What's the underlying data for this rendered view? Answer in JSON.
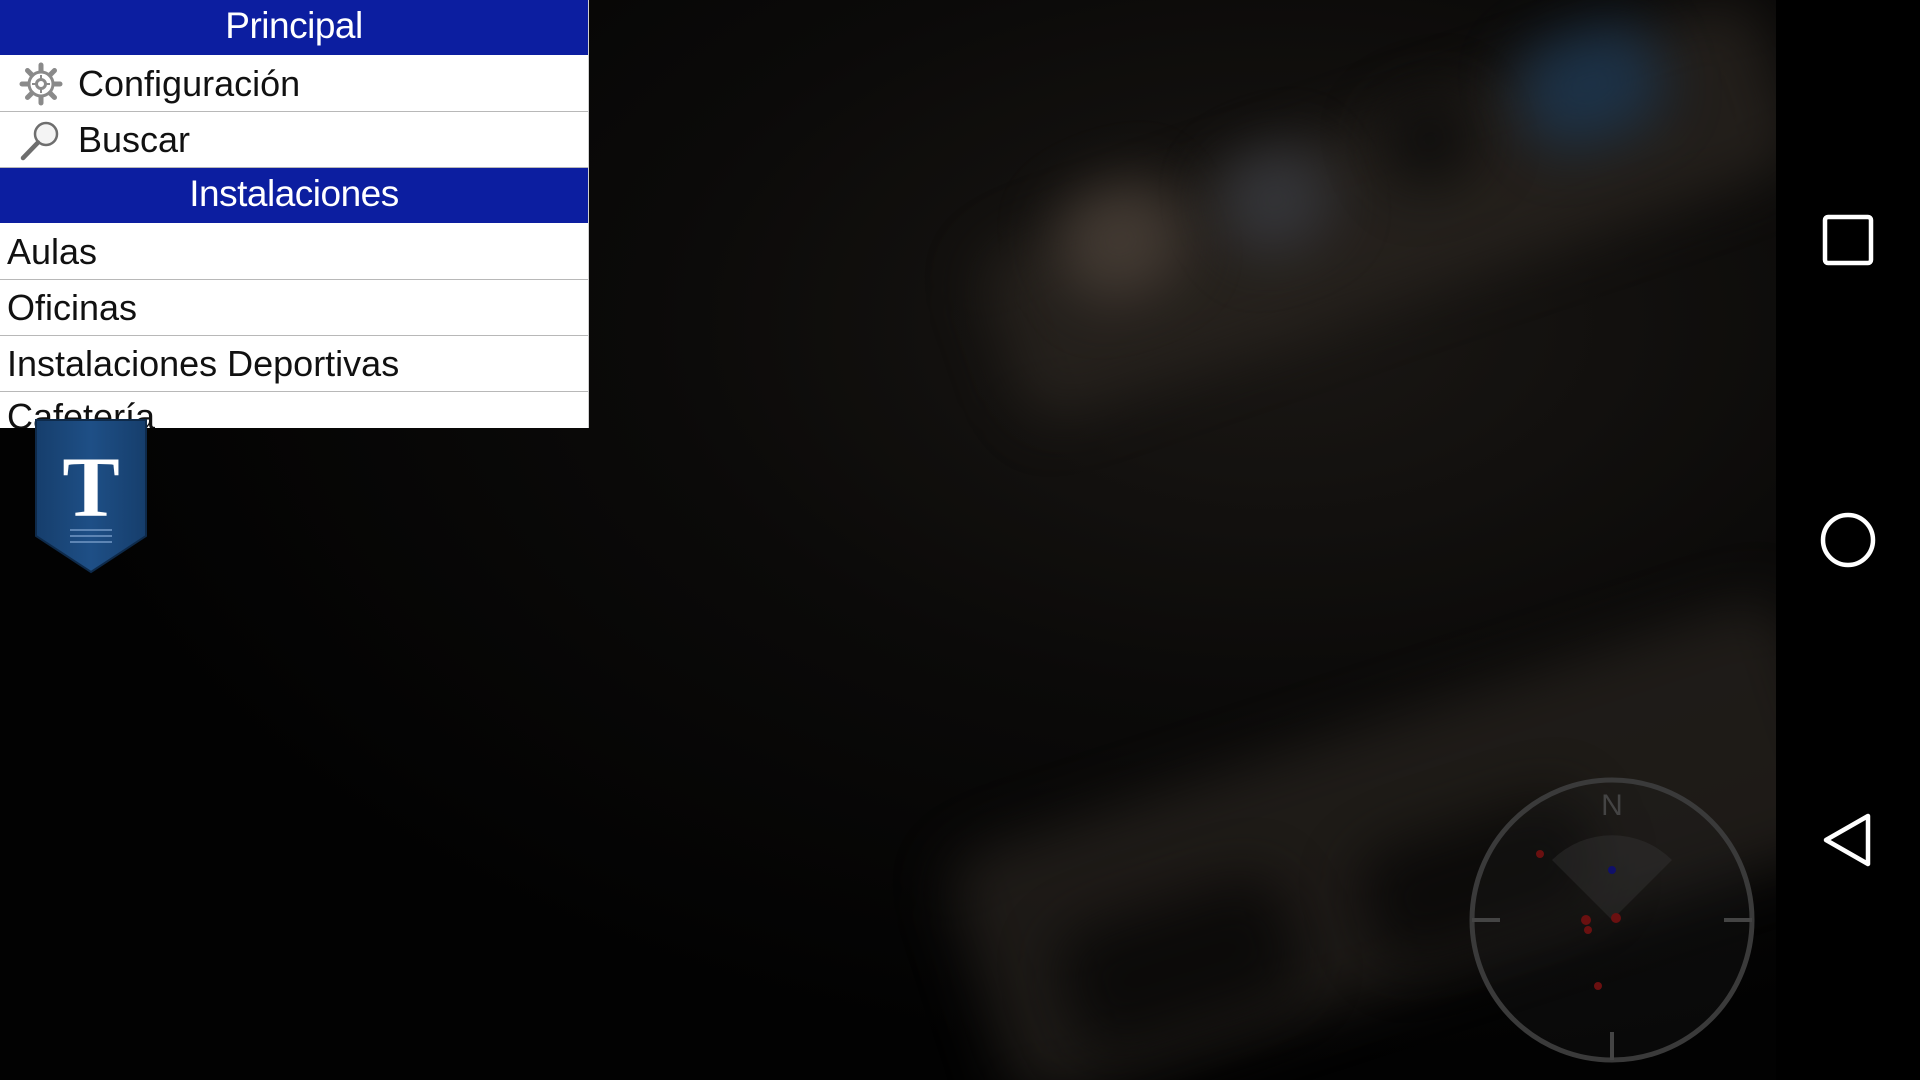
{
  "menu": {
    "sections": [
      {
        "header": "Principal",
        "items": [
          {
            "label": "Configuración",
            "icon": "gear-icon"
          },
          {
            "label": "Buscar",
            "icon": "magnifier-icon"
          }
        ]
      },
      {
        "header": "Instalaciones",
        "items": [
          {
            "label": "Aulas"
          },
          {
            "label": "Oficinas"
          },
          {
            "label": "Instalaciones Deportivas"
          },
          {
            "label": "Cafetería"
          }
        ]
      }
    ]
  },
  "logo": {
    "letter": "T",
    "colors": {
      "badge": "#1c4a7e",
      "letter": "#ffffff"
    }
  },
  "compass": {
    "north_label": "N"
  },
  "nav_bar": {
    "buttons": [
      "recent-apps-icon",
      "home-icon",
      "back-icon"
    ]
  },
  "colors": {
    "header_bg": "#0c1ea0",
    "header_text": "#ffffff",
    "item_text": "#111111",
    "divider": "#b8b8b8"
  }
}
